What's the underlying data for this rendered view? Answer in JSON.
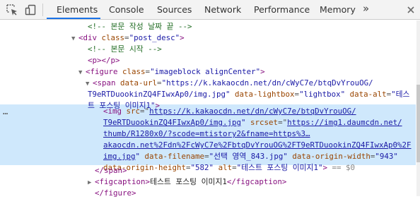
{
  "toolbar": {
    "inspect_icon": "cursor-arrow-icon",
    "device_icon": "device-toolbar-icon",
    "tabs": [
      {
        "label": "Elements",
        "active": true
      },
      {
        "label": "Console"
      },
      {
        "label": "Sources"
      },
      {
        "label": "Network"
      },
      {
        "label": "Performance"
      },
      {
        "label": "Memory"
      }
    ],
    "more_glyph": "»",
    "close_glyph": "×",
    "accent": "#1a73e8"
  },
  "tree": {
    "ellipsis": "…",
    "l1": {
      "comment": "<!-- 본문 작성 날짜 끝 -->"
    },
    "l2": {
      "open": "<div",
      "attr": "class",
      "val": "\"post_desc\"",
      "close": ">"
    },
    "l3": {
      "comment": "<!-- 본문 시작 -->"
    },
    "l4": {
      "text": "<p></p>"
    },
    "l5": {
      "open": "<figure",
      "attr": "class",
      "val": "\"imageblock alignCenter\"",
      "close": ">"
    },
    "l6": {
      "open": "<span",
      "a1": "data-url",
      "v1a": "\"https://k.kakaocdn.net/dn/cWyC7e/btqDvYrouOG/",
      "v1b": "T9eRTDuookinZQ4FIwxAp0/img.jpg\"",
      "a2": "data-lightbox",
      "v2": "\"lightbox\"",
      "a3": "data-alt",
      "v3a": "\"테스",
      "v3b": "트 포스팅 이미지1\"",
      "close": ">"
    },
    "l7": {
      "open": "<img",
      "a1": "src",
      "v1a": "https://k.kakaocdn.net/dn/cWyC7e/btqDvYrouOG/",
      "v1b": "T9eRTDuookinZQ4FIwxAp0/img.jpg",
      "a2": "srcset",
      "v2a": "https://img1.daumcdn.net/",
      "v2b": "thumb/R1280x0/?scode=mtistory2&fname=https%3…",
      "v2c": "akaocdn.net%2Fdn%2FcWyC7e%2FbtqDvYrouOG%2FT9eRTDuookinZQ4FIwxAp0%2F",
      "v2d": "img.jpg",
      "a3": "data-filename",
      "v3": "\"선택 영역_843.jpg\"",
      "a4": "data-origin-width",
      "v4": "\"943\"",
      "a5": "data-origin-height",
      "v5": "\"582\"",
      "a6": "alt",
      "v6": "\"테스트 포스팅 이미지1\"",
      "close": ">",
      "console_ref": "== $0"
    },
    "l8": {
      "text": "</span>"
    },
    "l9": {
      "open": "<figcaption>",
      "text": "테스트 포스팅 이미지1",
      "close": "</figcaption>"
    },
    "l10": {
      "text": "</figure>"
    }
  }
}
